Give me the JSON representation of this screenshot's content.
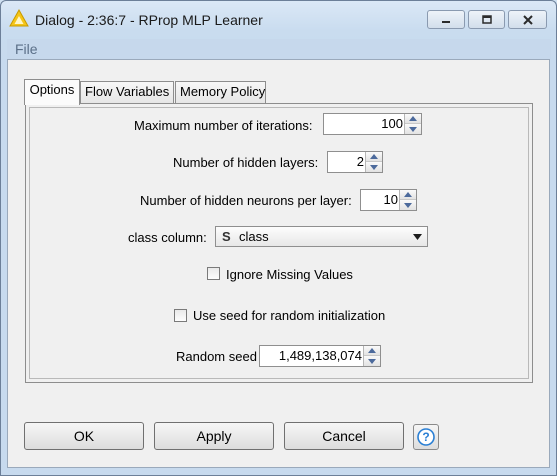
{
  "window": {
    "title": "Dialog - 2:36:7 - RProp MLP Learner",
    "menu": [
      "File"
    ]
  },
  "tabs": [
    "Options",
    "Flow Variables",
    "Memory Policy"
  ],
  "options": {
    "max_iterations_label": "Maximum number of iterations:",
    "max_iterations_value": "100",
    "hidden_layers_label": "Number of hidden layers:",
    "hidden_layers_value": "2",
    "hidden_neurons_label": "Number of hidden neurons per layer:",
    "hidden_neurons_value": "10",
    "class_column_label": "class column:",
    "class_column_type_icon": "S",
    "class_column_value": "class",
    "ignore_missing_label": "Ignore Missing Values",
    "ignore_missing_checked": false,
    "use_seed_label": "Use seed for random initialization",
    "use_seed_checked": false,
    "random_seed_label": "Random seed",
    "random_seed_value": "1,489,138,074"
  },
  "buttons": {
    "ok": "OK",
    "apply": "Apply",
    "cancel": "Cancel",
    "help_icon": "help-icon"
  },
  "colors": {
    "title_bar": "#c9dcef",
    "dialog_bg": "#f0f0f0",
    "help_accent": "#2a7fd4"
  }
}
